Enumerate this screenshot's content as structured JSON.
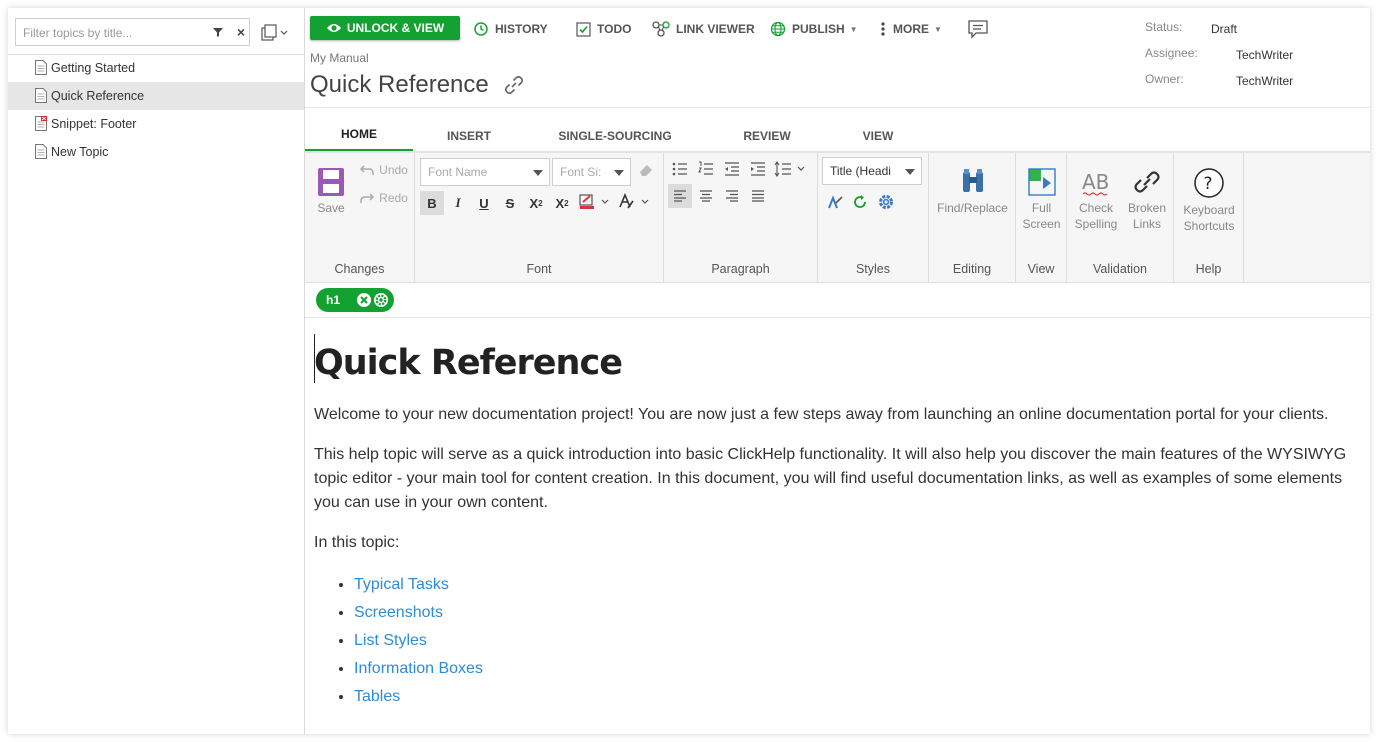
{
  "sidebar": {
    "filter_placeholder": "Filter topics by title...",
    "topics": [
      {
        "label": "Getting Started",
        "selected": false,
        "icon": "doc-icon"
      },
      {
        "label": "Quick Reference",
        "selected": true,
        "icon": "doc-icon"
      },
      {
        "label": "Snippet: Footer",
        "selected": false,
        "icon": "snippet-icon"
      },
      {
        "label": "New Topic",
        "selected": false,
        "icon": "doc-icon"
      }
    ]
  },
  "toolbar": {
    "unlock_label": "UNLOCK & VIEW",
    "history_label": "HISTORY",
    "todo_label": "TODO",
    "link_viewer_label": "LINK VIEWER",
    "publish_label": "PUBLISH",
    "more_label": "MORE"
  },
  "status": {
    "status_key": "Status:",
    "status_value": "Draft",
    "assignee_key": "Assignee:",
    "assignee_value": "TechWriter",
    "owner_key": "Owner:",
    "owner_value": "TechWriter"
  },
  "header": {
    "breadcrumb": "My Manual",
    "title": "Quick Reference"
  },
  "ribbon_tabs": [
    {
      "label": "HOME",
      "active": true
    },
    {
      "label": "INSERT",
      "active": false
    },
    {
      "label": "SINGLE-SOURCING",
      "active": false
    },
    {
      "label": "REVIEW",
      "active": false
    },
    {
      "label": "VIEW",
      "active": false
    }
  ],
  "ribbon": {
    "changes": {
      "label": "Changes",
      "save": "Save",
      "undo": "Undo",
      "redo": "Redo"
    },
    "font": {
      "label": "Font",
      "font_name_placeholder": "Font Name",
      "font_size_placeholder": "Font Si:"
    },
    "paragraph": {
      "label": "Paragraph"
    },
    "styles": {
      "label": "Styles",
      "style_value": "Title (Headi"
    },
    "editing": {
      "label": "Editing",
      "find_replace": "Find/Replace"
    },
    "view": {
      "label": "View",
      "full": "Full",
      "screen": "Screen"
    },
    "validation": {
      "label": "Validation",
      "check": "Check",
      "spelling": "Spelling",
      "broken": "Broken",
      "links": "Links"
    },
    "help": {
      "label": "Help",
      "keyboard": "Keyboard",
      "shortcuts": "Shortcuts"
    }
  },
  "element_bar": {
    "tag": "h1"
  },
  "document": {
    "heading": "Quick Reference",
    "para1": "Welcome to your new documentation project! You are now just a few steps away from launching an online documentation portal for your clients.",
    "para2": "This help topic will serve as a quick introduction into basic ClickHelp functionality. It will also help you discover the main features of the WYSIWYG topic editor - your main tool for content creation. In this document, you will find useful documentation links, as well as examples of some elements you can use in your own content.",
    "para3": "In this topic:",
    "links": [
      "Typical Tasks",
      "Screenshots",
      "List Styles",
      "Information Boxes",
      "Tables"
    ]
  },
  "colors": {
    "accent": "#13a232",
    "link": "#2e8bd6"
  }
}
